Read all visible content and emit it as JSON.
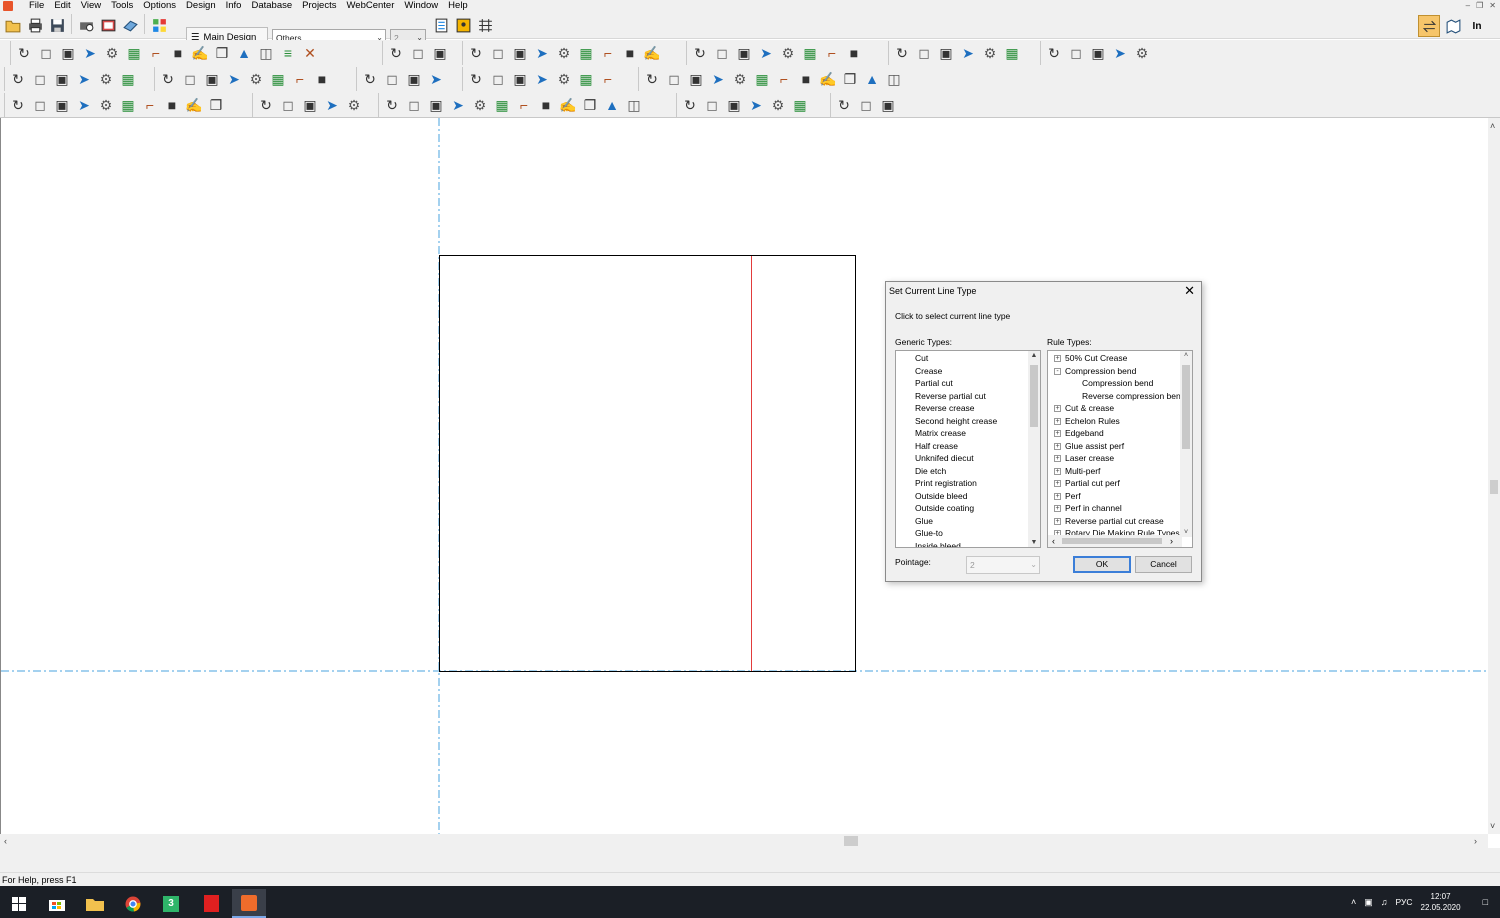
{
  "menubar": {
    "items": [
      "File",
      "Edit",
      "View",
      "Tools",
      "Options",
      "Design",
      "Info",
      "Database",
      "Projects",
      "WebCenter",
      "Window",
      "Help"
    ]
  },
  "toolbar": {
    "main_design_label": "Main Design",
    "layer_combo_value": "Others...",
    "pointage_combo_value": "2",
    "right_label": "In"
  },
  "dialog": {
    "title": "Set Current Line Type",
    "hint": "Click to select current line type",
    "generic_label": "Generic Types:",
    "rule_label": "Rule Types:",
    "generic_types": [
      "Cut",
      "Crease",
      "Partial cut",
      "Reverse partial cut",
      "Reverse crease",
      "Second height crease",
      "Matrix crease",
      "Half crease",
      "Unknifed diecut",
      "Die etch",
      "Print registration",
      "Outside bleed",
      "Outside coating",
      "Glue",
      "Glue-to",
      "Inside bleed"
    ],
    "rule_types": [
      {
        "label": "50% Cut Crease",
        "expander": "+",
        "indent": 0
      },
      {
        "label": "Compression bend",
        "expander": "-",
        "indent": 0
      },
      {
        "label": "Compression bend",
        "expander": "",
        "indent": 1
      },
      {
        "label": "Reverse compression ben",
        "expander": "",
        "indent": 1
      },
      {
        "label": "Cut & crease",
        "expander": "+",
        "indent": 0
      },
      {
        "label": "Echelon Rules",
        "expander": "+",
        "indent": 0
      },
      {
        "label": "Edgeband",
        "expander": "+",
        "indent": 0
      },
      {
        "label": "Glue assist perf",
        "expander": "+",
        "indent": 0
      },
      {
        "label": "Laser crease",
        "expander": "+",
        "indent": 0
      },
      {
        "label": "Multi-perf",
        "expander": "+",
        "indent": 0
      },
      {
        "label": "Partial cut perf",
        "expander": "+",
        "indent": 0
      },
      {
        "label": "Perf",
        "expander": "+",
        "indent": 0
      },
      {
        "label": "Perf in channel",
        "expander": "+",
        "indent": 0
      },
      {
        "label": "Reverse partial cut crease",
        "expander": "+",
        "indent": 0
      },
      {
        "label": "Rotary Die Making Rule Types",
        "expander": "+",
        "indent": 0
      }
    ],
    "pointage_label": "Pointage:",
    "pointage_value": "2",
    "ok_label": "OK",
    "cancel_label": "Cancel"
  },
  "status": {
    "text": "For Help, press F1"
  },
  "taskbar": {
    "lang": "РУС",
    "time": "12:07",
    "date": "22.05.2020"
  },
  "colors": {
    "crease_line": "#e23b3b",
    "guide_line": "#4aa3df",
    "accent": "#3b7ed8"
  }
}
